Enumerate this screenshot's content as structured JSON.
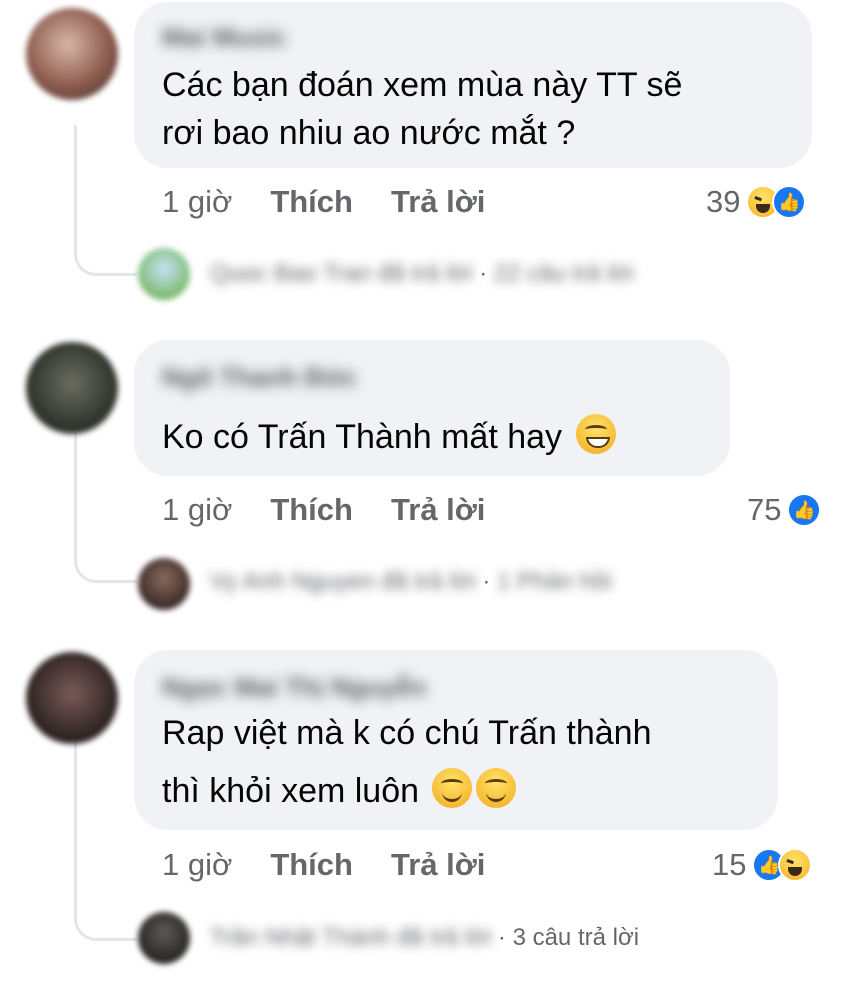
{
  "comments": [
    {
      "author": "Mai Music",
      "text_lines": [
        "Các bạn đoán xem mùa này TT sẽ",
        "rơi bao nhiu ao nước mắt ?"
      ],
      "time": "1 giờ",
      "like_label": "Thích",
      "reply_label": "Trả lời",
      "reaction_count": "39",
      "reactions": [
        "haha-icon",
        "like-icon"
      ],
      "reply_preview": {
        "name": "Quoc Bao Tran",
        "status": "đã trả lời",
        "count": "22 câu trả lời"
      }
    },
    {
      "author": "Ngô Thanh Đức",
      "text_lines": [
        "Ko có Trấn Thành mất hay"
      ],
      "time": "1 giờ",
      "like_label": "Thích",
      "reply_label": "Trả lời",
      "reaction_count": "75",
      "reactions": [
        "like-icon"
      ],
      "reply_preview": {
        "name": "Vy Anh Nguyen",
        "status": "đã trả lời",
        "count": "1 Phản hồi"
      }
    },
    {
      "author": "Ngọc Mai Thị Nguyễn",
      "text_lines": [
        "Rap việt mà k có chú Trấn thành",
        "thì khỏi xem luôn"
      ],
      "time": "1 giờ",
      "like_label": "Thích",
      "reply_label": "Trả lời",
      "reaction_count": "15",
      "reactions": [
        "like-icon",
        "haha-icon"
      ],
      "reply_preview": {
        "name": "Trần Nhật Thành",
        "status": "đã trả lời",
        "count": "3 câu trả lời"
      }
    }
  ],
  "colors": {
    "bubble": "#f0f2f5",
    "meta": "#65676b",
    "like_blue": "#1877f2"
  }
}
